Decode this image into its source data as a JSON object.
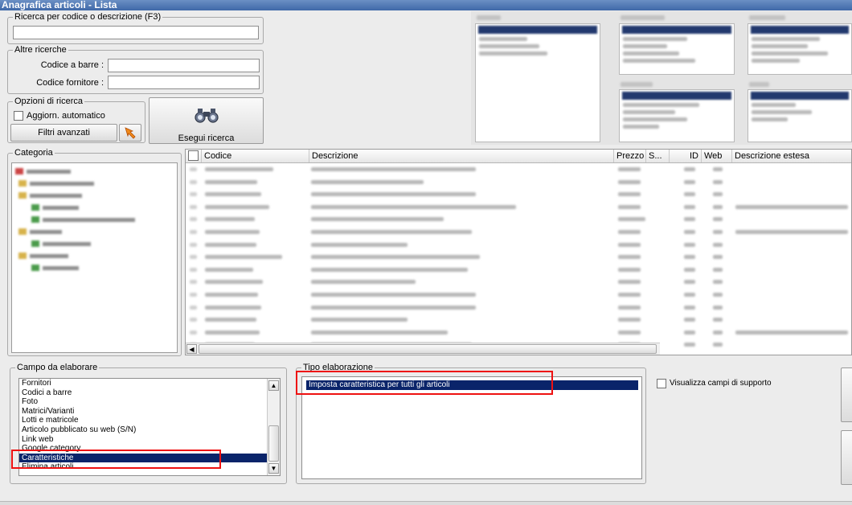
{
  "window": {
    "title": "Anagrafica articoli  - Lista"
  },
  "search": {
    "group_label": "Ricerca per codice o descrizione (F3)",
    "value": ""
  },
  "other_search": {
    "group_label": "Altre ricerche",
    "barcode_label": "Codice a barre :",
    "barcode_value": "",
    "supplier_label": "Codice fornitore :",
    "supplier_value": ""
  },
  "options": {
    "group_label": "Opzioni di ricerca",
    "auto_update_label": "Aggiorn. automatico",
    "advanced_filters_label": "Filtri avanzati",
    "run_search_label": "Esegui ricerca"
  },
  "category": {
    "group_label": "Categoria"
  },
  "grid": {
    "columns": [
      {
        "key": "check",
        "label": ""
      },
      {
        "key": "codice",
        "label": "Codice"
      },
      {
        "key": "descrizione",
        "label": "Descrizione"
      },
      {
        "key": "prezzo",
        "label": "Prezzo"
      },
      {
        "key": "s",
        "label": "S..."
      },
      {
        "key": "id",
        "label": "ID"
      },
      {
        "key": "web",
        "label": "Web"
      },
      {
        "key": "desc_estesa",
        "label": "Descrizione estesa"
      }
    ]
  },
  "field_panel": {
    "group_label": "Campo da elaborare",
    "items": [
      "Fornitori",
      "Codici a barre",
      "Foto",
      "Matrici/Varianti",
      "Lotti e matricole",
      "Articolo pubblicato su web (S/N)",
      "Link web",
      "Google category",
      "Caratteristiche",
      "Elimina articoli"
    ],
    "selected_index": 8
  },
  "type_panel": {
    "group_label": "Tipo elaborazione",
    "items": [
      "Imposta caratteristica per tutti gli articoli"
    ],
    "selected_index": 0
  },
  "support_fields": {
    "label": "Visualizza campi di supporto"
  },
  "icons": {
    "search_button": "binoculars-icon",
    "filter_button": "arrow-pointer-icon",
    "scroll_up": "arrow-up-icon",
    "scroll_down": "arrow-down-icon",
    "scroll_left": "arrow-left-icon"
  },
  "colors": {
    "selection": "#0a246a",
    "highlight": "#e11111",
    "titlebar": "#4a72b0"
  }
}
